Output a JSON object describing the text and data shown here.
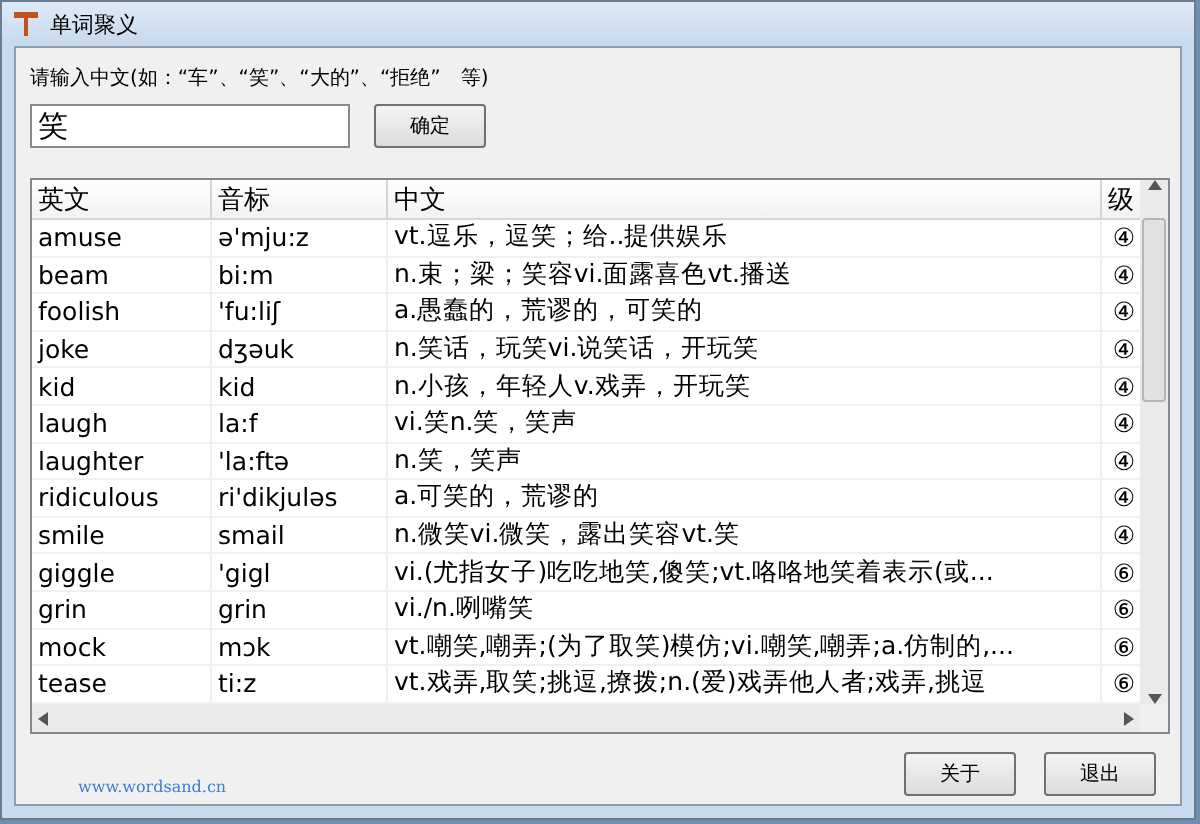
{
  "window": {
    "title": "单词聚义"
  },
  "prompt": "请输入中文(如：“车”、“笑”、“大的”、“拒绝”　等)",
  "search": {
    "value": "笑"
  },
  "confirm_button": "确定",
  "table": {
    "columns": [
      "英文",
      "音标",
      "中文",
      "级"
    ],
    "rows": [
      [
        "amuse",
        "ə'mju:z",
        "vt.逗乐，逗笑；给..提供娱乐",
        "④"
      ],
      [
        "beam",
        "bi:m",
        "n.束；梁；笑容vi.面露喜色vt.播送",
        "④"
      ],
      [
        "foolish",
        "'fu:liʃ",
        "a.愚蠢的，荒谬的，可笑的",
        "④"
      ],
      [
        "joke",
        "dʒəuk",
        "n.笑话，玩笑vi.说笑话，开玩笑",
        "④"
      ],
      [
        "kid",
        "kid",
        "n.小孩，年轻人v.戏弄，开玩笑",
        "④"
      ],
      [
        "laugh",
        "la:f",
        "vi.笑n.笑，笑声",
        "④"
      ],
      [
        "laughter",
        "'la:ftə",
        "n.笑，笑声",
        "④"
      ],
      [
        "ridiculous",
        "ri'dikjuləs",
        "a.可笑的，荒谬的",
        "④"
      ],
      [
        "smile",
        "smail",
        "n.微笑vi.微笑，露出笑容vt.笑",
        "④"
      ],
      [
        "giggle",
        "'gigl",
        "vi.(尤指女子)吃吃地笑,傻笑;vt.咯咯地笑着表示(或...",
        "⑥"
      ],
      [
        "grin",
        "grin",
        "vi./n.咧嘴笑",
        "⑥"
      ],
      [
        "mock",
        "mɔk",
        "vt.嘲笑,嘲弄;(为了取笑)模仿;vi.嘲笑,嘲弄;a.仿制的,...",
        "⑥"
      ],
      [
        "tease",
        "ti:z",
        "vt.戏弄,取笑;挑逗,撩拨;n.(爱)戏弄他人者;戏弄,挑逗",
        "⑥"
      ]
    ]
  },
  "website_link": "www.wordsand.cn",
  "buttons": [
    "关于",
    "退出"
  ]
}
